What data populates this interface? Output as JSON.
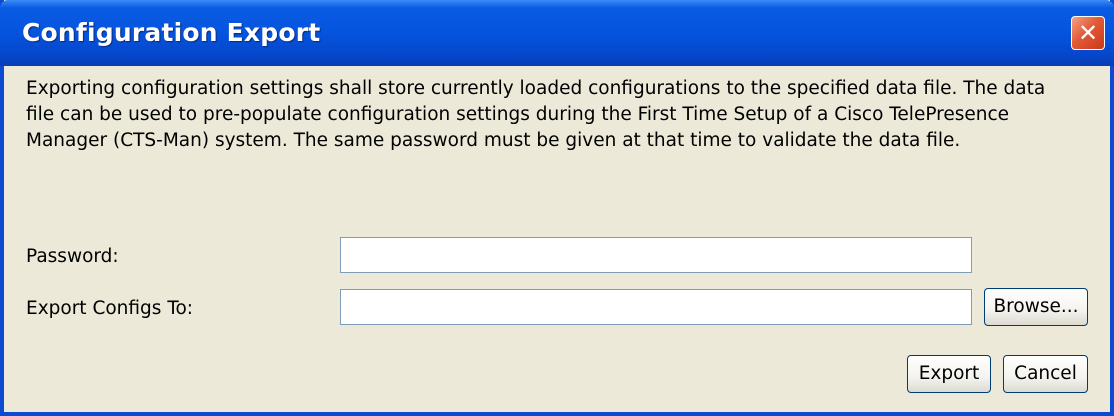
{
  "dialog": {
    "title": "Configuration Export",
    "close_icon": "close-icon",
    "close_glyph": "✕",
    "description": "Exporting configuration settings shall store currently loaded configurations to the specified data file. The data file can be used to pre-populate configuration settings during the First Time Setup of a Cisco TelePresence Manager (CTS-Man) system. The same password must be given at that time to validate the data file."
  },
  "form": {
    "password_label": "Password:",
    "password_value": "",
    "export_label": "Export Configs To:",
    "export_value": "",
    "browse_label": "Browse..."
  },
  "actions": {
    "export_label": "Export",
    "cancel_label": "Cancel"
  },
  "colors": {
    "titlebar": "#0554de",
    "dialog_bg": "#ece9d8",
    "close_button": "#e25a36"
  }
}
